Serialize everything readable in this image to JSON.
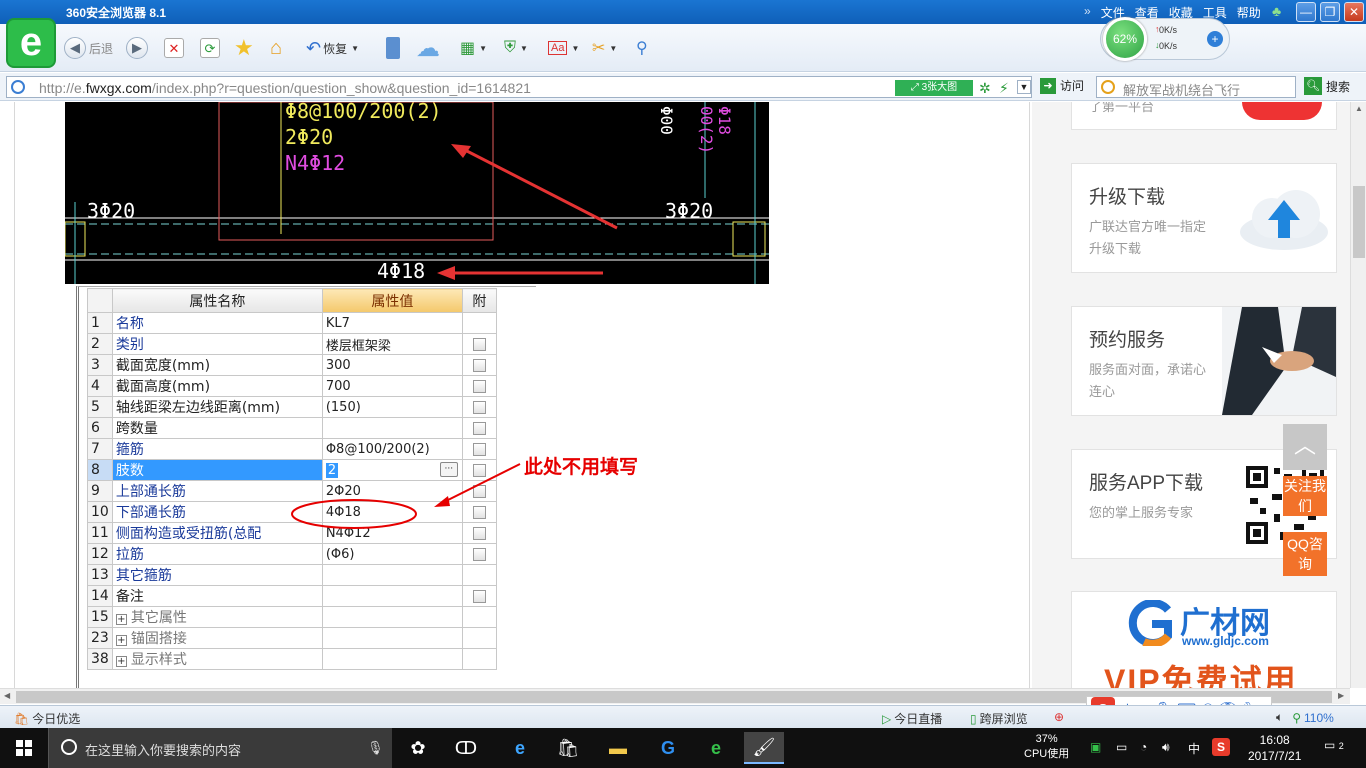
{
  "browser": {
    "title": "360安全浏览器 8.1",
    "menus": [
      "文件",
      "查看",
      "收藏",
      "工具",
      "帮助"
    ],
    "toolbar": {
      "back_label": "后退",
      "restore_label": "恢复",
      "net_percent": "62%",
      "up_speed": "0K/s",
      "down_speed": "0K/s"
    },
    "address": {
      "url_prefix": "http://e.",
      "url_domain": "fwxgx.com",
      "url_path": "/index.php?r=question/question_show&question_id=1614821",
      "big_image_label": "3张大图",
      "go_label": "访问",
      "search_placeholder": "解放军战机绕台飞行",
      "search_label": "搜索"
    }
  },
  "cad": {
    "labels": {
      "top_stirrup": "Φ8@100/200(2)",
      "top_bars": "2Φ20",
      "side_bars": "N4Φ12",
      "left_bars": "3Φ20",
      "right_bars": "3Φ20",
      "bottom_bars": "4Φ18",
      "vert_right_a": "Φ18",
      "vert_right_b": "00(2)",
      "vert_small": "Φ00"
    }
  },
  "grid": {
    "header": {
      "name": "属性名称",
      "value": "属性值",
      "attach": "附"
    },
    "rows": [
      {
        "num": "1",
        "name": "名称",
        "value": "KL7",
        "check": false,
        "style": "blue"
      },
      {
        "num": "2",
        "name": "类别",
        "value": "楼层框架梁",
        "check": true,
        "style": "blue"
      },
      {
        "num": "3",
        "name": "截面宽度(mm)",
        "value": "300",
        "check": true,
        "style": "plain"
      },
      {
        "num": "4",
        "name": "截面高度(mm)",
        "value": "700",
        "check": true,
        "style": "plain"
      },
      {
        "num": "5",
        "name": "轴线距梁左边线距离(mm)",
        "value": "(150)",
        "check": true,
        "style": "plain"
      },
      {
        "num": "6",
        "name": "跨数量",
        "value": "",
        "check": true,
        "style": "plain"
      },
      {
        "num": "7",
        "name": "箍筋",
        "value": "Φ8@100/200(2)",
        "check": true,
        "style": "blue"
      },
      {
        "num": "8",
        "name": "肢数",
        "value": "2",
        "check": true,
        "style": "selected"
      },
      {
        "num": "9",
        "name": "上部通长筋",
        "value": "2Φ20",
        "check": true,
        "style": "blue"
      },
      {
        "num": "10",
        "name": "下部通长筋",
        "value": "4Φ18",
        "check": true,
        "style": "blue"
      },
      {
        "num": "11",
        "name": "侧面构造或受扭筋(总配",
        "value": "N4Φ12",
        "check": true,
        "style": "blue"
      },
      {
        "num": "12",
        "name": "拉筋",
        "value": "(Φ6)",
        "check": true,
        "style": "blue"
      },
      {
        "num": "13",
        "name": "其它箍筋",
        "value": "",
        "check": false,
        "style": "blue"
      },
      {
        "num": "14",
        "name": "备注",
        "value": "",
        "check": true,
        "style": "plain"
      },
      {
        "num": "15",
        "name": "其它属性",
        "value": "",
        "check": false,
        "style": "group"
      },
      {
        "num": "23",
        "name": "锚固搭接",
        "value": "",
        "check": false,
        "style": "group"
      },
      {
        "num": "38",
        "name": "显示样式",
        "value": "",
        "check": false,
        "style": "group"
      }
    ]
  },
  "annotation": "此处不用填写",
  "sidebar": {
    "cards": [
      {
        "title": "升级下载",
        "desc": "广联达官方唯一指定升级下载"
      },
      {
        "title": "预约服务",
        "desc": "服务面对面，承诺心连心"
      },
      {
        "title": "服务APP下载",
        "desc": "您的掌上服务专家"
      }
    ],
    "top_card_text": "了第一平台",
    "follow_label": "关注我们",
    "qq_label": "QQ咨询",
    "ad_brand": "广材网",
    "ad_url": "www.gldjc.com",
    "ad_banner": "VIP免费试用"
  },
  "statusbar": {
    "left": "今日优选",
    "live": "今日直播",
    "cross": "跨屏浏览",
    "zoom": "110%",
    "ime": "中"
  },
  "taskbar": {
    "search_placeholder": "在这里输入你要搜索的内容",
    "cpu_percent": "37%",
    "cpu_label": "CPU使用",
    "ime": "中",
    "time": "16:08",
    "date": "2017/7/21",
    "notif_count": "2"
  },
  "colors": {
    "title_blue": "#1a75d2",
    "cad_yellow": "#f0ea5c",
    "cad_magenta": "#e04ce0",
    "cad_red": "#e53333",
    "select_blue": "#3399ff",
    "accent_orange": "#f2722a"
  }
}
